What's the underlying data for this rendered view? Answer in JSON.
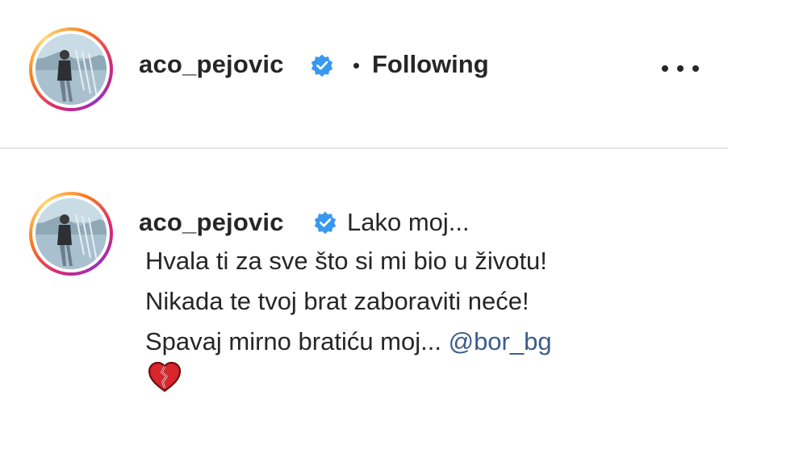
{
  "post": {
    "author": {
      "username": "aco_pejovic",
      "verified": true,
      "follow_status": "Following"
    },
    "more_options_icon": "more-horizontal-icon",
    "caption": {
      "username": "aco_pejovic",
      "first_line": "Lako moj...",
      "line_2": "Hvala ti za sve što si mi bio u životu!",
      "line_3": "Nikada te tvoj brat zaboraviti neće!",
      "line_4_text": "Spavaj mirno bratiću moj... ",
      "mention": "@bor_bg",
      "emoji_icon": "broken-heart-icon"
    }
  },
  "colors": {
    "verified_blue": "#3897f0",
    "mention": "#3b5d8a",
    "text": "#262626",
    "divider": "#e3e3e3",
    "broken_heart": "#d8262b"
  }
}
